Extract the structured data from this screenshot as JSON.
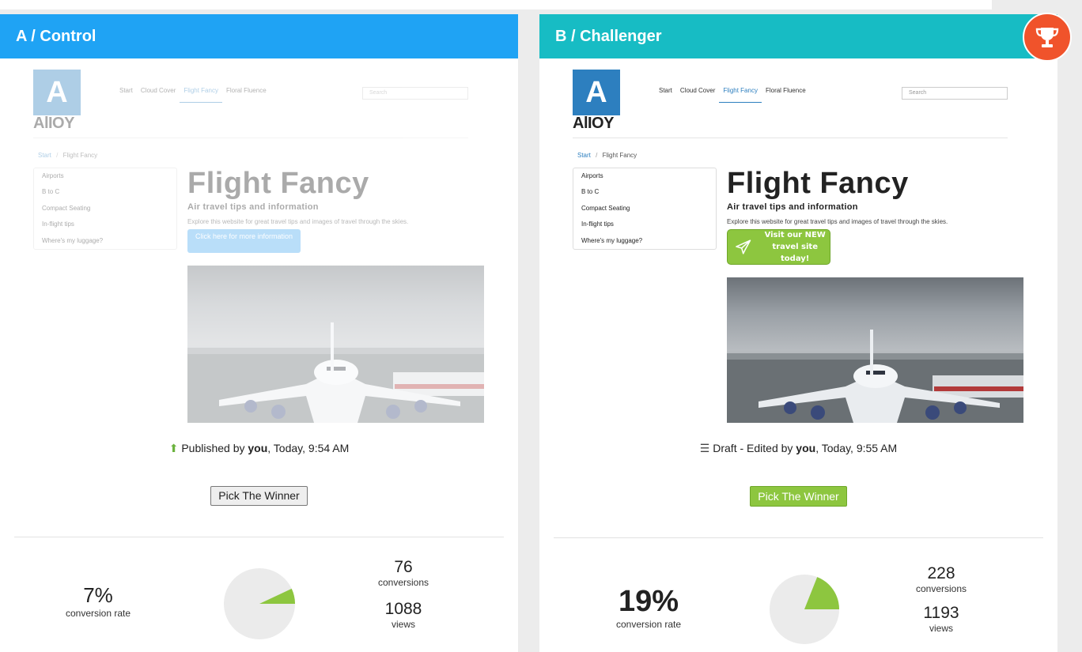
{
  "variants": {
    "a": {
      "title": "A / Control",
      "cta_text": "Click here for more information",
      "status_prefix": "Published by ",
      "status_user": "you",
      "status_suffix": ", Today, 9:54 AM",
      "pick_label": "Pick The Winner",
      "rate": "7%",
      "rate_label": "conversion rate",
      "conversions": "76",
      "conversions_label": "conversions",
      "views": "1088",
      "views_label": "views",
      "pie_fraction": 0.07
    },
    "b": {
      "title": "B / Challenger",
      "cta_line1": "Visit our NEW",
      "cta_line2": "travel site today!",
      "status_prefix": "Draft - Edited by ",
      "status_user": "you",
      "status_suffix": ", Today, 9:55 AM",
      "pick_label": "Pick The Winner",
      "rate": "19%",
      "rate_label": "conversion rate",
      "conversions": "228",
      "conversions_label": "conversions",
      "views": "1193",
      "views_label": "views",
      "pie_fraction": 0.19
    }
  },
  "site": {
    "logo_letter": "A",
    "logo_word": "AlIOY",
    "nav": [
      "Start",
      "Cloud Cover",
      "Flight Fancy",
      "Floral Fluence"
    ],
    "nav_active": "Flight Fancy",
    "search_placeholder": "Search",
    "breadcrumb_start": "Start",
    "breadcrumb_sep": "/",
    "breadcrumb_current": "Flight Fancy",
    "menu": [
      "Airports",
      "B to C",
      "Compact Seating",
      "In-flight tips",
      "Where's my luggage?"
    ],
    "heading": "Flight Fancy",
    "subheading": "Air travel tips and information",
    "lead": "Explore this website for great travel tips and images of travel through the skies."
  },
  "colors": {
    "control_header": "#1fa3f4",
    "challenger_header": "#17bcc4",
    "trophy": "#f0532b",
    "winner_green": "#8dc63f"
  },
  "icons": {
    "trophy": "trophy-icon",
    "published": "arrow-up-icon",
    "draft": "layers-icon",
    "airplane": "airplane-icon"
  }
}
